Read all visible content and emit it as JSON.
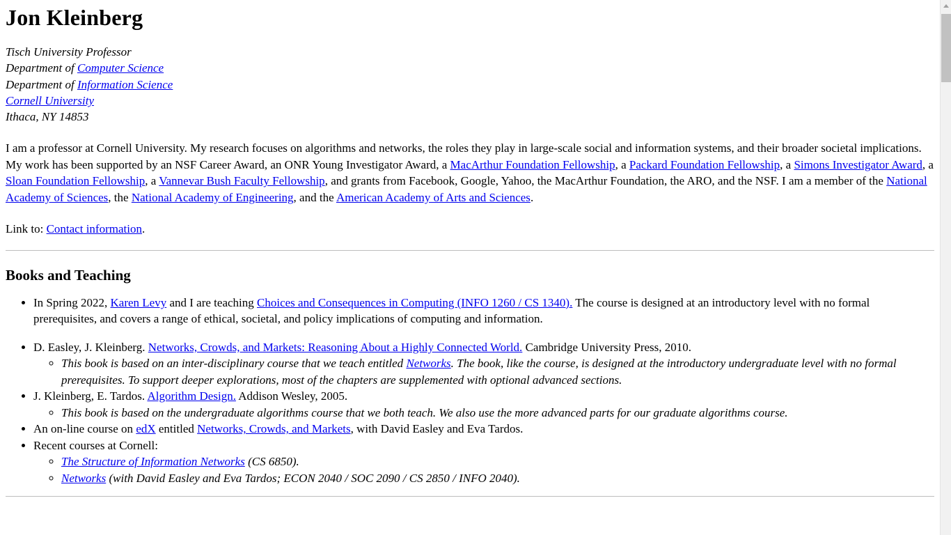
{
  "page": {
    "title": "Jon Kleinberg"
  },
  "address": {
    "lines": [
      {
        "prefix": "Tisch University Professor",
        "link": "",
        "suffix": ""
      },
      {
        "prefix": "Department of ",
        "link": "Computer Science",
        "suffix": ""
      },
      {
        "prefix": "Department of ",
        "link": "Information Science",
        "suffix": ""
      },
      {
        "prefix": "",
        "link": "Cornell University",
        "suffix": ""
      },
      {
        "prefix": "Ithaca, NY 14853",
        "link": "",
        "suffix": ""
      }
    ]
  },
  "bio": {
    "t1": "I am a professor at Cornell University. My research focuses on algorithms and networks, the roles they play in large-scale social and information systems, and their broader societal implications. My work has been supported by an NSF Career Award, an ONR Young Investigator Award, a ",
    "l1": "MacArthur Foundation Fellowship",
    "t2": ", a ",
    "l2": "Packard Foundation Fellowship",
    "t3": ", a ",
    "l3": "Simons Investigator Award",
    "t4": ", a ",
    "l4": "Sloan Foundation Fellowship",
    "t5": ", a ",
    "l5": "Vannevar Bush Faculty Fellowship",
    "t6": ", and grants from Facebook, Google, Yahoo, the MacArthur Foundation, the ARO, and the NSF. I am a member of the ",
    "l6": "National Academy of Sciences",
    "t7": ", the ",
    "l7": "National Academy of Engineering",
    "t8": ", and the ",
    "l8": "American Academy of Arts and Sciences",
    "t9": "."
  },
  "contact": {
    "prefix": "Link to: ",
    "link": "Contact information",
    "suffix": "."
  },
  "books_section": {
    "heading": "Books and Teaching",
    "item_spring": {
      "t1": "In Spring 2022, ",
      "l1": "Karen Levy",
      "t2": " and I are teaching ",
      "l2": "Choices and Consequences in Computing (INFO 1260 / CS 1340).",
      "t3": " The course is designed at an introductory level with no formal prerequisites, and covers a range of ethical, societal, and policy implications of computing and information."
    },
    "item_ecn": {
      "t1": "D. Easley, J. Kleinberg. ",
      "l1": "Networks, Crowds, and Markets: Reasoning About a Highly Connected World.",
      "t2": " Cambridge University Press, 2010.",
      "sub_t1": "This book is based on an inter-disciplinary course that we teach entitled ",
      "sub_l1": "Networks",
      "sub_t2": ". The book, like the course, is designed at the introductory undergraduate level with no formal prerequisites. To support deeper explorations, most of the chapters are supplemented with optional advanced sections."
    },
    "item_algo": {
      "t1": "J. Kleinberg, E. Tardos. ",
      "l1": "Algorithm Design.",
      "t2": " Addison Wesley, 2005.",
      "sub_t1": "This book is based on the undergraduate algorithms course that we both teach. We also use the more advanced parts for our graduate algorithms course."
    },
    "item_edx": {
      "t1": "An on-line course on ",
      "l1": "edX",
      "t2": " entitled ",
      "l2": "Networks, Crowds, and Markets",
      "t3": ", with David Easley and Eva Tardos."
    },
    "item_recent": {
      "t1": "Recent courses at Cornell:",
      "sub1_link": "The Structure of Information Networks",
      "sub1_text": " (CS 6850).",
      "sub2_link": "Networks",
      "sub2_text": " (with David Easley and Eva Tardos; ECON 2040 / SOC 2090 / CS 2850 / INFO 2040)."
    }
  },
  "colors": {
    "link": "#0000EE",
    "text": "#000000",
    "rule": "#BDBDBD",
    "scrollbar_track": "#F1F1F1",
    "scrollbar_thumb": "#C1C1C1"
  }
}
